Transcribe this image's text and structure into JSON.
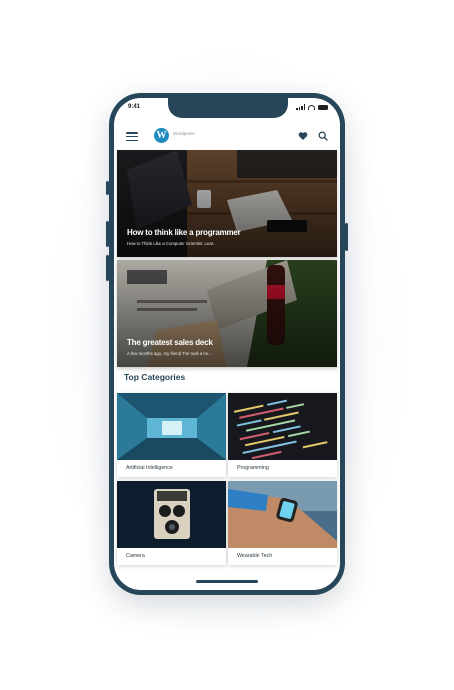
{
  "status": {
    "time": "9:41"
  },
  "appbar": {
    "logo_letter": "W",
    "app_name": "Wordpress"
  },
  "articles": [
    {
      "title": "How to think like a programmer",
      "subtitle": "How to Think Like a Computer Scientist. Lear.."
    },
    {
      "title": "The greatest sales deck",
      "subtitle": "A few months ago, my friend Tim took a ne..."
    }
  ],
  "categories_section": {
    "title": "Top Categories",
    "items": [
      {
        "label": "Artificial Intelligence"
      },
      {
        "label": "Programming"
      },
      {
        "label": "Camera"
      },
      {
        "label": "Wearable Tech"
      }
    ]
  },
  "colors": {
    "frame": "#27465a",
    "brand": "#1e8cbe",
    "heading": "#27465a"
  }
}
